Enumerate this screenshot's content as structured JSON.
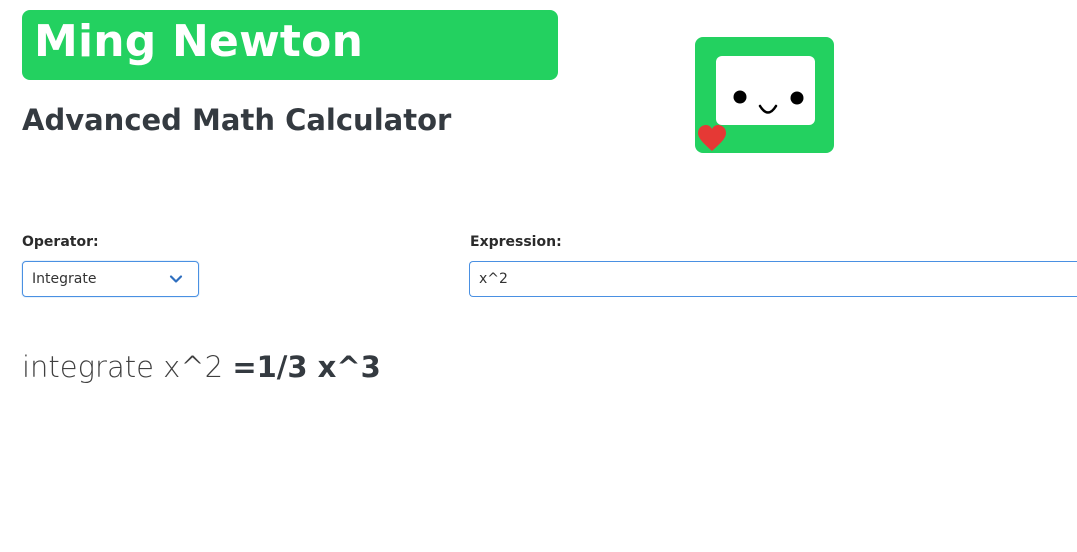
{
  "header": {
    "brand_title": "Ming Newton",
    "subtitle": "Advanced Math Calculator"
  },
  "mascot": {
    "icon": "robot-face-with-heart-icon",
    "colors": {
      "body": "#23d160",
      "screen": "#ffffff",
      "features": "#000000",
      "heart": "#e53935"
    }
  },
  "form": {
    "operator_label": "Operator:",
    "operator_selected": "Integrate",
    "expression_label": "Expression:",
    "expression_value": "x^2"
  },
  "result": {
    "expression_text": "integrate x^2",
    "answer_text": "=1/3 x^3"
  },
  "colors": {
    "brand": "#23d160",
    "focus_border": "#4a90e2",
    "text": "#343a40"
  }
}
